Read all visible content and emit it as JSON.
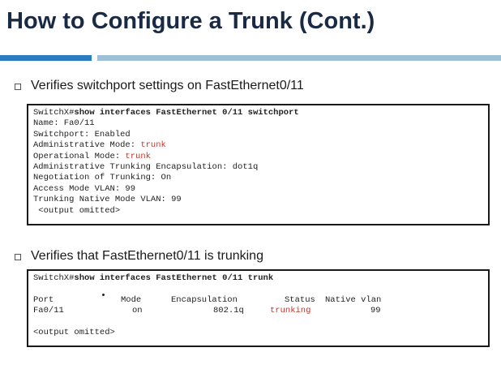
{
  "title": "How to Configure a Trunk (Cont.)",
  "bullets": [
    {
      "text": "Verifies switchport settings on FastEthernet0/11"
    },
    {
      "text": "Verifies that FastEthernet0/11  is trunking"
    }
  ],
  "terminal1": {
    "prompt": "SwitchX#",
    "command": "show interfaces FastEthernet 0/11 switchport",
    "lines": [
      {
        "label": "Name: Fa0/11",
        "value": ""
      },
      {
        "label": "Switchport: Enabled",
        "value": ""
      },
      {
        "label": "Administrative Mode: ",
        "value": "trunk"
      },
      {
        "label": "Operational Mode: ",
        "value": "trunk"
      },
      {
        "label": "Administrative Trunking Encapsulation: dot1q",
        "value": ""
      },
      {
        "label": "Negotiation of Trunking: On",
        "value": ""
      },
      {
        "label": "Access Mode VLAN: 99",
        "value": ""
      },
      {
        "label": "Trunking Native Mode VLAN: 99",
        "value": ""
      },
      {
        "label": " <output omitted>",
        "value": ""
      }
    ]
  },
  "terminal2": {
    "prompt": "SwitchX#",
    "command": "show interfaces FastEthernet 0/11 trunk",
    "headers": [
      "Port",
      "Mode",
      "Encapsulation",
      "Status",
      "Native vlan"
    ],
    "row": [
      "Fa0/11",
      "on",
      "802.1q",
      "trunking",
      "99"
    ],
    "footer": "<output omitted>"
  },
  "colors": {
    "title": "#1a2a44",
    "accent_dark": "#2a7bc0",
    "accent_light": "#9dbfd8",
    "highlight": "#c0392b"
  }
}
